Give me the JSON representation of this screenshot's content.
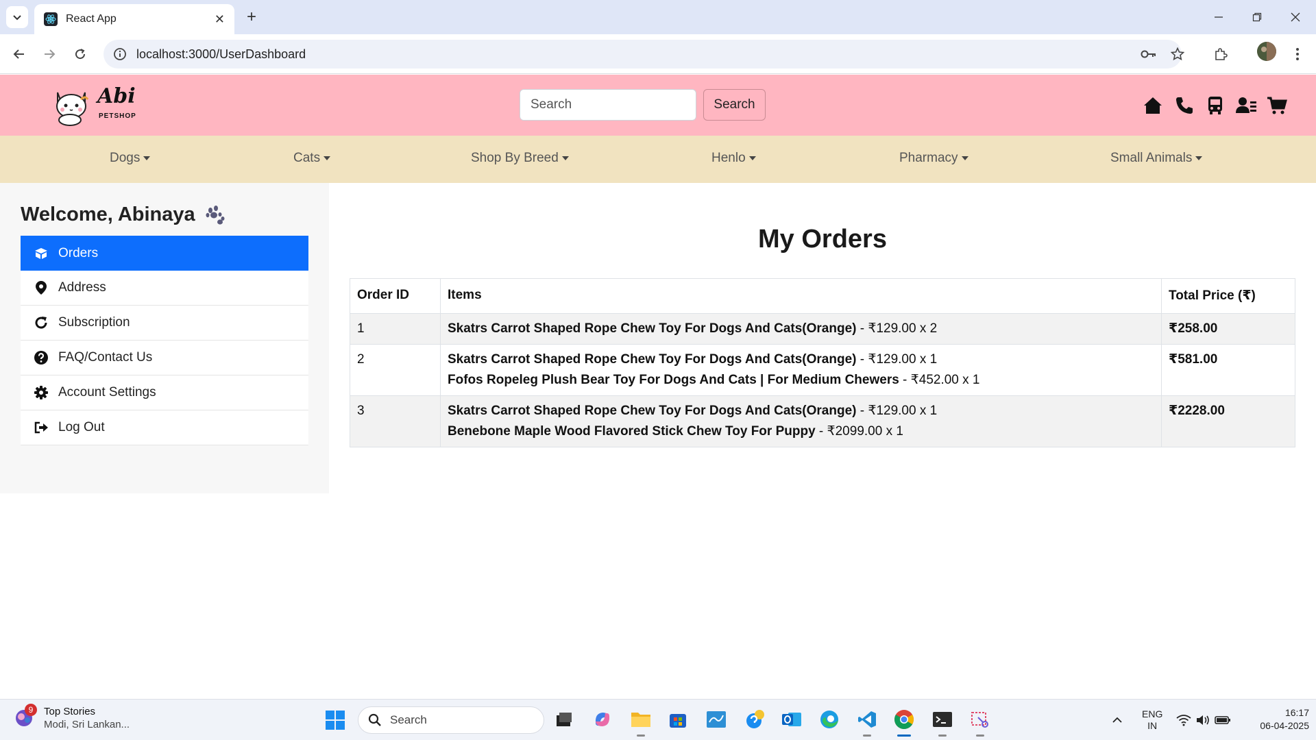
{
  "browser": {
    "tab_title": "React App",
    "tab_close": "✕",
    "new_tab": "+",
    "url": "localhost:3000/UserDashboard"
  },
  "header": {
    "logo_text": "Abi",
    "logo_subtext": "PETSHOP",
    "search_placeholder": "Search",
    "search_button": "Search"
  },
  "categories": [
    {
      "label": "Dogs"
    },
    {
      "label": "Cats"
    },
    {
      "label": "Shop By Breed"
    },
    {
      "label": "Henlo"
    },
    {
      "label": "Pharmacy"
    },
    {
      "label": "Small Animals"
    }
  ],
  "sidebar": {
    "welcome": "Welcome, Abinaya",
    "items": [
      {
        "label": "Orders",
        "icon": "box-icon",
        "active": true
      },
      {
        "label": "Address",
        "icon": "map-pin-icon"
      },
      {
        "label": "Subscription",
        "icon": "refresh-icon"
      },
      {
        "label": "FAQ/Contact Us",
        "icon": "question-circle-icon"
      },
      {
        "label": "Account Settings",
        "icon": "gear-icon"
      },
      {
        "label": "Log Out",
        "icon": "logout-icon"
      }
    ]
  },
  "orders": {
    "title": "My Orders",
    "columns": [
      "Order ID",
      "Items",
      "Total Price (₹)"
    ],
    "rows": [
      {
        "id": "1",
        "items": [
          {
            "name": "Skatrs Carrot Shaped Rope Chew Toy For Dogs And Cats(Orange)",
            "detail": " - ₹129.00 x 2"
          }
        ],
        "total": "₹258.00"
      },
      {
        "id": "2",
        "items": [
          {
            "name": "Skatrs Carrot Shaped Rope Chew Toy For Dogs And Cats(Orange)",
            "detail": " - ₹129.00 x 1"
          },
          {
            "name": "Fofos Ropeleg Plush Bear Toy For Dogs And Cats | For Medium Chewers",
            "detail": " - ₹452.00 x 1"
          }
        ],
        "total": "₹581.00"
      },
      {
        "id": "3",
        "items": [
          {
            "name": "Skatrs Carrot Shaped Rope Chew Toy For Dogs And Cats(Orange)",
            "detail": " - ₹129.00 x 1"
          },
          {
            "name": "Benebone Maple Wood Flavored Stick Chew Toy For Puppy",
            "detail": " - ₹2099.00 x 1"
          }
        ],
        "total": "₹2228.00"
      }
    ]
  },
  "taskbar": {
    "news_badge": "9",
    "news_title": "Top Stories",
    "news_sub": "Modi, Sri Lankan...",
    "search_label": "Search",
    "lang_line1": "ENG",
    "lang_line2": "IN",
    "time": "16:17",
    "date": "06-04-2025"
  },
  "colors": {
    "header_bg": "#ffb6c1",
    "nav_bg": "#f1e3c0",
    "active_menu": "#0d6efd"
  }
}
